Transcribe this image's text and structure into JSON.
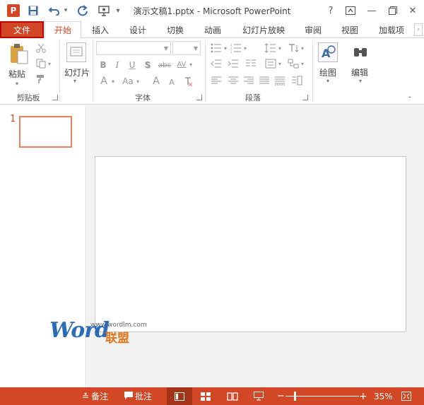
{
  "titlebar": {
    "app_logo": "P",
    "document_title": "演示文稿1.pptx - Microsoft PowerPoint",
    "help": "?",
    "minimize": "—",
    "close": "✕"
  },
  "tabs": [
    {
      "label": "文件"
    },
    {
      "label": "开始"
    },
    {
      "label": "插入"
    },
    {
      "label": "设计"
    },
    {
      "label": "切换"
    },
    {
      "label": "动画"
    },
    {
      "label": "幻灯片放映"
    },
    {
      "label": "审阅"
    },
    {
      "label": "视图"
    },
    {
      "label": "加载项"
    }
  ],
  "ribbon": {
    "clipboard": {
      "label": "剪贴板",
      "paste": "粘贴"
    },
    "slides": {
      "new_slide": "幻灯片"
    },
    "font": {
      "label": "字体",
      "bold": "B",
      "italic": "I",
      "underline": "U",
      "shadow": "S",
      "strike": "abc",
      "spacing": "AV",
      "fontcolor": "A",
      "case": "Aa",
      "grow": "A",
      "shrink": "A"
    },
    "paragraph": {
      "label": "段落"
    },
    "drawing": {
      "label": "绘图"
    },
    "editing": {
      "label": "编辑"
    }
  },
  "thumbnails": {
    "slide_number": "1"
  },
  "watermark": {
    "brand": "Word",
    "brand_cn": "联盟",
    "url": "www.wordlm.com"
  },
  "statusbar": {
    "notes": "备注",
    "comments": "批注",
    "zoom_minus": "−",
    "zoom_plus": "+",
    "zoom_level": "35%"
  },
  "colors": {
    "accent": "#d24726",
    "file_tab_border": "#c00000"
  }
}
